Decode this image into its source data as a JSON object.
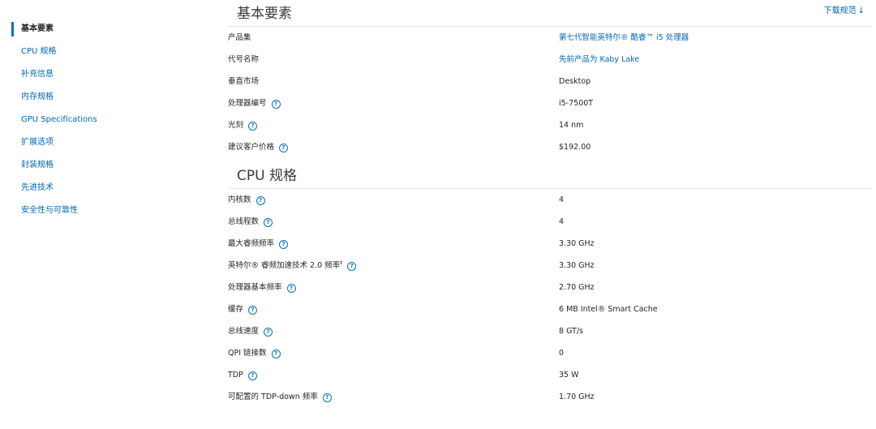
{
  "download": {
    "label": "下载规范",
    "arrow": "↓"
  },
  "sidebar": {
    "items": [
      {
        "label": "基本要素",
        "active": true
      },
      {
        "label": "CPU 规格"
      },
      {
        "label": "补充信息"
      },
      {
        "label": "内存规格"
      },
      {
        "label": "GPU Specifications"
      },
      {
        "label": "扩展选项"
      },
      {
        "label": "封装规格"
      },
      {
        "label": "先进技术"
      },
      {
        "label": "安全性与可靠性"
      }
    ]
  },
  "sections": [
    {
      "title": "基本要素",
      "rows": [
        {
          "label": "产品集",
          "value": "第七代智能英特尔® 酷睿™ i5 处理器",
          "link": true,
          "help": false
        },
        {
          "label": "代号名称",
          "value": "先前产品为 Kaby Lake",
          "link": true,
          "help": false
        },
        {
          "label": "垂直市场",
          "value": "Desktop",
          "link": false,
          "help": false
        },
        {
          "label": "处理器编号",
          "value": "i5-7500T",
          "link": false,
          "help": true
        },
        {
          "label": "光刻",
          "value": "14 nm",
          "link": false,
          "help": true
        },
        {
          "label": "建议客户价格",
          "value": "$192.00",
          "link": false,
          "help": true
        }
      ]
    },
    {
      "title": "CPU 规格",
      "rows": [
        {
          "label": "内核数",
          "value": "4",
          "link": false,
          "help": true
        },
        {
          "label": "总线程数",
          "value": "4",
          "link": false,
          "help": true
        },
        {
          "label": "最大睿频频率",
          "value": "3.30 GHz",
          "link": false,
          "help": true
        },
        {
          "label": "英特尔® 睿频加速技术 2.0 频率",
          "sup": "‡",
          "value": "3.30 GHz",
          "link": false,
          "help": true
        },
        {
          "label": "处理器基本频率",
          "value": "2.70 GHz",
          "link": false,
          "help": true
        },
        {
          "label": "缓存",
          "value": "6 MB Intel® Smart Cache",
          "link": false,
          "help": true
        },
        {
          "label": "总线速度",
          "value": "8 GT/s",
          "link": false,
          "help": true
        },
        {
          "label": "QPI 链接数",
          "value": "0",
          "link": false,
          "help": true
        },
        {
          "label": "TDP",
          "value": "35 W",
          "link": false,
          "help": true
        },
        {
          "label": "可配置的 TDP-down 频率",
          "value": "1.70 GHz",
          "link": false,
          "help": true
        }
      ]
    }
  ],
  "icons": {
    "help": "?"
  },
  "colors": {
    "link": "#0068b5",
    "accent": "#0071c5"
  }
}
